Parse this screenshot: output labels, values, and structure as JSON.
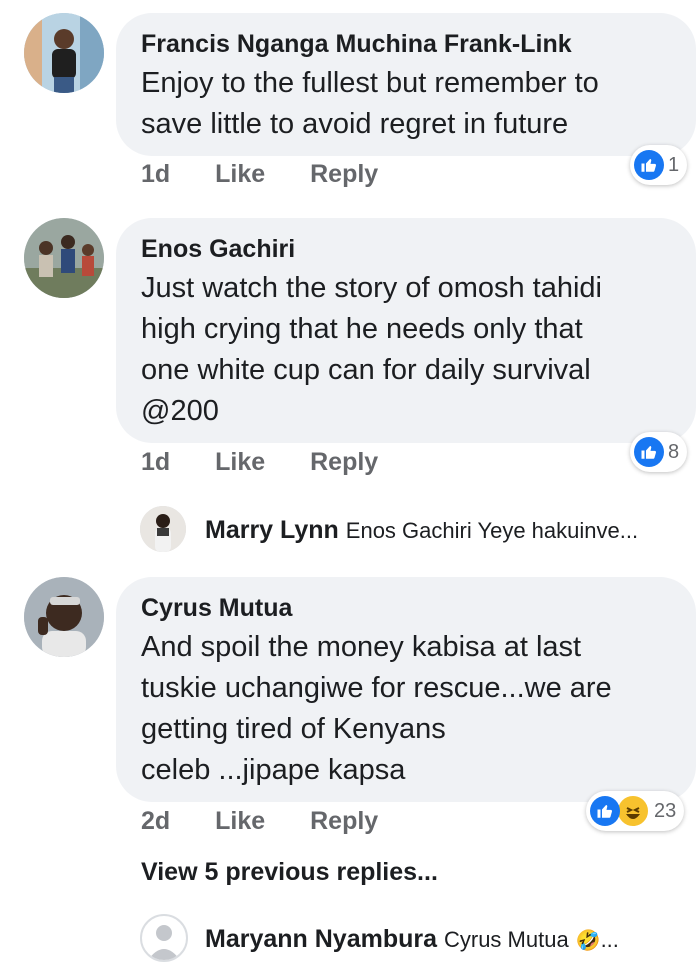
{
  "comments": [
    {
      "author": "Francis Nganga Muchina Frank-Link",
      "text": "Enjoy to the fullest but remember to\nsave little to avoid regret in future",
      "time": "1d",
      "like_label": "Like",
      "reply_label": "Reply",
      "reaction_count": "1"
    },
    {
      "author": "Enos Gachiri",
      "text": "Just watch the story of omosh tahidi\nhigh crying that he needs only that\none white cup can for daily survival\n@200",
      "time": "1d",
      "like_label": "Like",
      "reply_label": "Reply",
      "reaction_count": "8",
      "reply": {
        "author": "Marry Lynn",
        "text": "Enos Gachiri Yeye hakuinve..."
      }
    },
    {
      "author": "Cyrus Mutua",
      "text": "And spoil the money kabisa at last\ntuskie uchangiwe for rescue...we are\ngetting tired of Kenyans\nceleb ...jipape kapsa",
      "time": "2d",
      "like_label": "Like",
      "reply_label": "Reply",
      "reaction_count": "23",
      "view_previous": "View 5 previous replies...",
      "reply": {
        "author": "Maryann Nyambura",
        "text": "Cyrus Mutua",
        "emoji": "🤣",
        "suffix": "..."
      }
    }
  ],
  "colors": {
    "bubble": "#f0f2f5",
    "meta": "#65676b",
    "like_blue": "#1877f2",
    "haha_yellow": "#f7c22e"
  },
  "icons": [
    "like-reaction-icon",
    "haha-reaction-icon",
    "avatar"
  ]
}
